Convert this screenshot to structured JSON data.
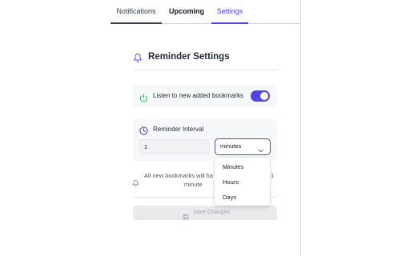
{
  "tabs": [
    {
      "label": "Notifications"
    },
    {
      "label": "Upcoming"
    },
    {
      "label": "Settings",
      "active": true
    }
  ],
  "header": {
    "title": "Reminder Settings",
    "icon": "bell-icon"
  },
  "listen": {
    "label": "Listen to new added bookmarks",
    "enabled": true,
    "icon": "power-icon"
  },
  "interval": {
    "label": "Reminder Interval",
    "icon": "clock-icon",
    "value": "1",
    "unit_selected": "minutes",
    "unit_options": [
      "Minutes",
      "Hours",
      "Days"
    ]
  },
  "info": {
    "text_line1": "All new bookmarks will ha",
    "text_suffix": "1",
    "text_line2": "minute"
  },
  "save_button": {
    "label": "Save Changes",
    "icon": "save-icon",
    "disabled": true
  },
  "colors": {
    "accent": "#4f46e5",
    "power_icon": "#22c55e",
    "card_bg": "#f7f8f9"
  }
}
